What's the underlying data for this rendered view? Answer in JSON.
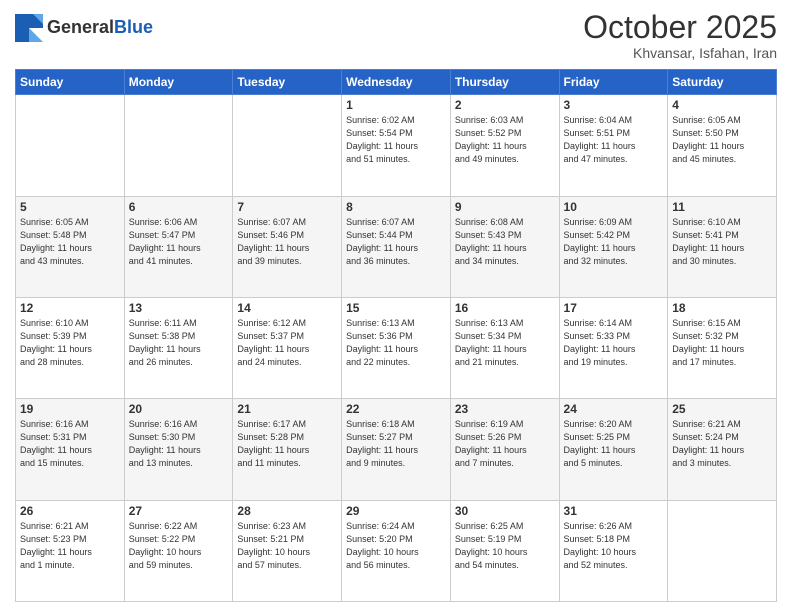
{
  "header": {
    "logo_line1": "General",
    "logo_line2": "Blue",
    "month": "October 2025",
    "location": "Khvansar, Isfahan, Iran"
  },
  "weekdays": [
    "Sunday",
    "Monday",
    "Tuesday",
    "Wednesday",
    "Thursday",
    "Friday",
    "Saturday"
  ],
  "weeks": [
    [
      {
        "day": "",
        "info": ""
      },
      {
        "day": "",
        "info": ""
      },
      {
        "day": "",
        "info": ""
      },
      {
        "day": "1",
        "info": "Sunrise: 6:02 AM\nSunset: 5:54 PM\nDaylight: 11 hours\nand 51 minutes."
      },
      {
        "day": "2",
        "info": "Sunrise: 6:03 AM\nSunset: 5:52 PM\nDaylight: 11 hours\nand 49 minutes."
      },
      {
        "day": "3",
        "info": "Sunrise: 6:04 AM\nSunset: 5:51 PM\nDaylight: 11 hours\nand 47 minutes."
      },
      {
        "day": "4",
        "info": "Sunrise: 6:05 AM\nSunset: 5:50 PM\nDaylight: 11 hours\nand 45 minutes."
      }
    ],
    [
      {
        "day": "5",
        "info": "Sunrise: 6:05 AM\nSunset: 5:48 PM\nDaylight: 11 hours\nand 43 minutes."
      },
      {
        "day": "6",
        "info": "Sunrise: 6:06 AM\nSunset: 5:47 PM\nDaylight: 11 hours\nand 41 minutes."
      },
      {
        "day": "7",
        "info": "Sunrise: 6:07 AM\nSunset: 5:46 PM\nDaylight: 11 hours\nand 39 minutes."
      },
      {
        "day": "8",
        "info": "Sunrise: 6:07 AM\nSunset: 5:44 PM\nDaylight: 11 hours\nand 36 minutes."
      },
      {
        "day": "9",
        "info": "Sunrise: 6:08 AM\nSunset: 5:43 PM\nDaylight: 11 hours\nand 34 minutes."
      },
      {
        "day": "10",
        "info": "Sunrise: 6:09 AM\nSunset: 5:42 PM\nDaylight: 11 hours\nand 32 minutes."
      },
      {
        "day": "11",
        "info": "Sunrise: 6:10 AM\nSunset: 5:41 PM\nDaylight: 11 hours\nand 30 minutes."
      }
    ],
    [
      {
        "day": "12",
        "info": "Sunrise: 6:10 AM\nSunset: 5:39 PM\nDaylight: 11 hours\nand 28 minutes."
      },
      {
        "day": "13",
        "info": "Sunrise: 6:11 AM\nSunset: 5:38 PM\nDaylight: 11 hours\nand 26 minutes."
      },
      {
        "day": "14",
        "info": "Sunrise: 6:12 AM\nSunset: 5:37 PM\nDaylight: 11 hours\nand 24 minutes."
      },
      {
        "day": "15",
        "info": "Sunrise: 6:13 AM\nSunset: 5:36 PM\nDaylight: 11 hours\nand 22 minutes."
      },
      {
        "day": "16",
        "info": "Sunrise: 6:13 AM\nSunset: 5:34 PM\nDaylight: 11 hours\nand 21 minutes."
      },
      {
        "day": "17",
        "info": "Sunrise: 6:14 AM\nSunset: 5:33 PM\nDaylight: 11 hours\nand 19 minutes."
      },
      {
        "day": "18",
        "info": "Sunrise: 6:15 AM\nSunset: 5:32 PM\nDaylight: 11 hours\nand 17 minutes."
      }
    ],
    [
      {
        "day": "19",
        "info": "Sunrise: 6:16 AM\nSunset: 5:31 PM\nDaylight: 11 hours\nand 15 minutes."
      },
      {
        "day": "20",
        "info": "Sunrise: 6:16 AM\nSunset: 5:30 PM\nDaylight: 11 hours\nand 13 minutes."
      },
      {
        "day": "21",
        "info": "Sunrise: 6:17 AM\nSunset: 5:28 PM\nDaylight: 11 hours\nand 11 minutes."
      },
      {
        "day": "22",
        "info": "Sunrise: 6:18 AM\nSunset: 5:27 PM\nDaylight: 11 hours\nand 9 minutes."
      },
      {
        "day": "23",
        "info": "Sunrise: 6:19 AM\nSunset: 5:26 PM\nDaylight: 11 hours\nand 7 minutes."
      },
      {
        "day": "24",
        "info": "Sunrise: 6:20 AM\nSunset: 5:25 PM\nDaylight: 11 hours\nand 5 minutes."
      },
      {
        "day": "25",
        "info": "Sunrise: 6:21 AM\nSunset: 5:24 PM\nDaylight: 11 hours\nand 3 minutes."
      }
    ],
    [
      {
        "day": "26",
        "info": "Sunrise: 6:21 AM\nSunset: 5:23 PM\nDaylight: 11 hours\nand 1 minute."
      },
      {
        "day": "27",
        "info": "Sunrise: 6:22 AM\nSunset: 5:22 PM\nDaylight: 10 hours\nand 59 minutes."
      },
      {
        "day": "28",
        "info": "Sunrise: 6:23 AM\nSunset: 5:21 PM\nDaylight: 10 hours\nand 57 minutes."
      },
      {
        "day": "29",
        "info": "Sunrise: 6:24 AM\nSunset: 5:20 PM\nDaylight: 10 hours\nand 56 minutes."
      },
      {
        "day": "30",
        "info": "Sunrise: 6:25 AM\nSunset: 5:19 PM\nDaylight: 10 hours\nand 54 minutes."
      },
      {
        "day": "31",
        "info": "Sunrise: 6:26 AM\nSunset: 5:18 PM\nDaylight: 10 hours\nand 52 minutes."
      },
      {
        "day": "",
        "info": ""
      }
    ]
  ]
}
